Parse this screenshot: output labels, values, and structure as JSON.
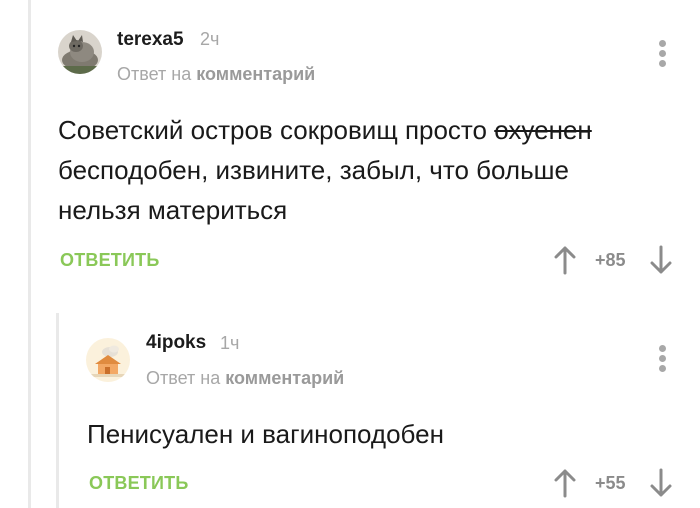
{
  "comments": [
    {
      "username": "terexa5",
      "time": "2ч",
      "reply_prefix": "Ответ на",
      "reply_target": "комментарий",
      "text_before": "Советский остров сокровищ просто ",
      "text_struck": "охуенен",
      "text_after": " бесподобен, извините, забыл, что больше нельзя материться",
      "reply_label": "ОТВЕТИТЬ",
      "rating": "+85",
      "avatar_icon": "cat-photo-avatar"
    },
    {
      "username": "4ipoks",
      "time": "1ч",
      "reply_prefix": "Ответ на",
      "reply_target": "комментарий",
      "text": "Пенисуален и вагиноподобен",
      "reply_label": "ОТВЕТИТЬ",
      "rating": "+55",
      "avatar_icon": "house-cartoon-avatar"
    }
  ],
  "colors": {
    "accent": "#8ac858",
    "muted": "#a7a7a7",
    "thread": "#e9e9e9"
  }
}
